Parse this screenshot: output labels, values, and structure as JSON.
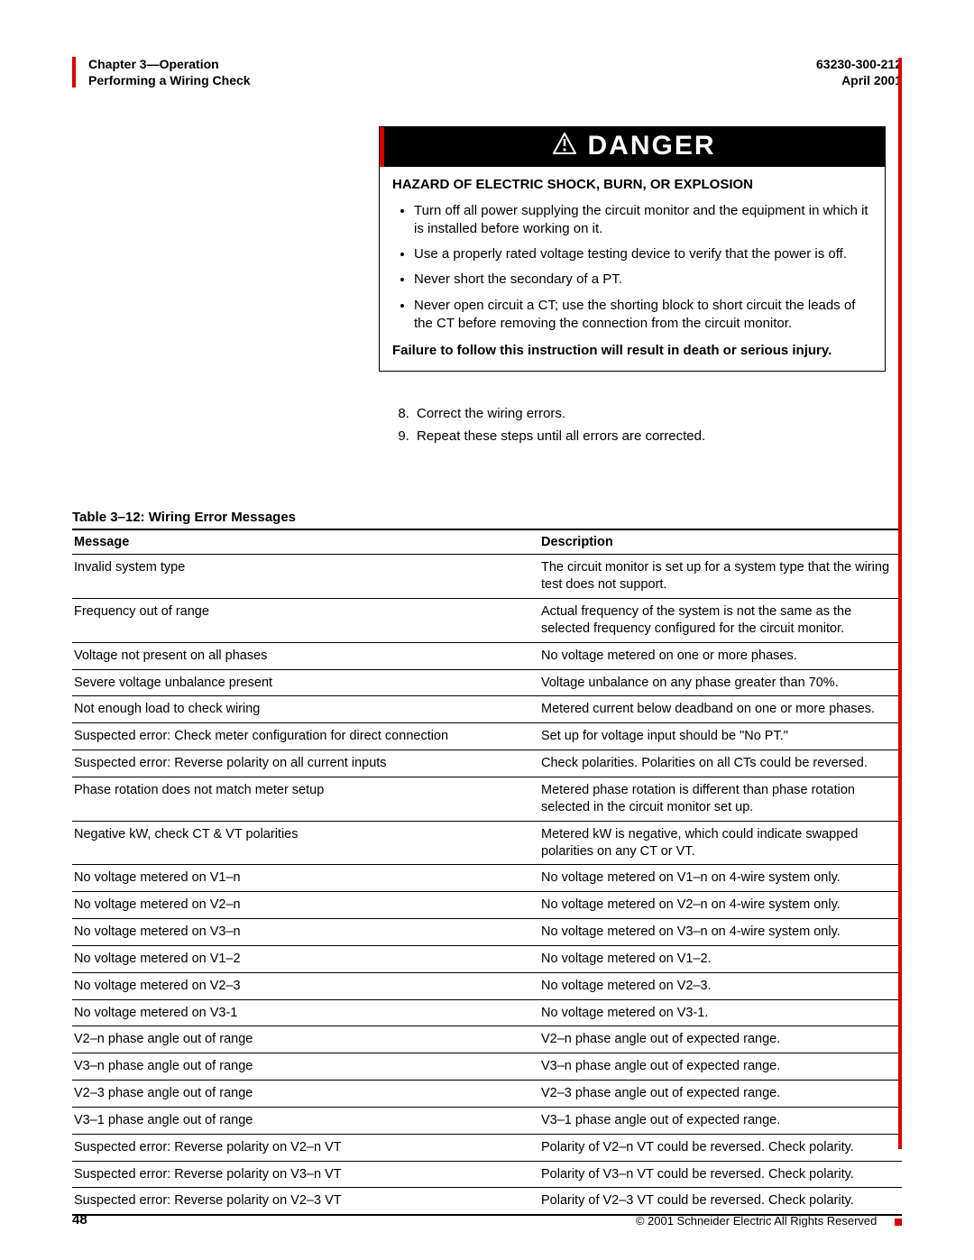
{
  "header": {
    "chapter": "Chapter 3—Operation",
    "section": "Performing a Wiring Check",
    "docnum": "63230-300-212",
    "date": "April 2001"
  },
  "danger": {
    "title": "DANGER",
    "hazard": "HAZARD OF ELECTRIC SHOCK, BURN, OR EXPLOSION",
    "bullets": [
      "Turn off all power supplying the circuit monitor and the equipment in which it is installed before working on it.",
      "Use a properly rated voltage testing device to verify that the power is off.",
      "Never short the secondary of a PT.",
      "Never open circuit a CT; use the shorting block to short circuit the leads of the CT before removing the connection from the circuit monitor."
    ],
    "failure": "Failure to follow this instruction will result in death or serious injury."
  },
  "steps": {
    "items": [
      "Correct the wiring errors.",
      "Repeat these steps until all errors are corrected."
    ]
  },
  "table": {
    "caption": "Table 3–12: Wiring Error Messages",
    "head": {
      "col1": "Message",
      "col2": "Description"
    },
    "rows": [
      {
        "msg": "Invalid system type",
        "desc": "The circuit monitor is set up for a system type that the wiring test does not support."
      },
      {
        "msg": "Frequency out of range",
        "desc": "Actual frequency of the system is not the same as the selected frequency configured for the circuit monitor."
      },
      {
        "msg": "Voltage not present on all phases",
        "desc": "No voltage metered on one or more phases."
      },
      {
        "msg": "Severe voltage unbalance present",
        "desc": "Voltage unbalance on any phase greater than 70%."
      },
      {
        "msg": "Not enough load to check wiring",
        "desc": "Metered current below deadband on one or more phases."
      },
      {
        "msg": "Suspected error: Check meter configuration for direct connection",
        "desc": "Set up for voltage input should be \"No PT.\""
      },
      {
        "msg": "Suspected error: Reverse polarity on all current inputs",
        "desc": "Check polarities. Polarities on all CTs could be reversed."
      },
      {
        "msg": "Phase rotation does not match meter setup",
        "desc": "Metered phase rotation is different than phase rotation selected in the circuit monitor set up."
      },
      {
        "msg": "Negative kW, check CT & VT polarities",
        "desc": "Metered kW is negative, which could indicate swapped polarities on any CT or VT."
      },
      {
        "msg": "No voltage metered on V1–n",
        "desc": "No voltage metered on V1–n on 4-wire system only."
      },
      {
        "msg": "No voltage metered on V2–n",
        "desc": "No voltage metered on V2–n on 4-wire system only."
      },
      {
        "msg": "No voltage metered on V3–n",
        "desc": "No voltage metered on V3–n on 4-wire system only."
      },
      {
        "msg": "No voltage metered on V1–2",
        "desc": "No voltage metered on V1–2."
      },
      {
        "msg": "No voltage metered on V2–3",
        "desc": "No voltage metered on V2–3."
      },
      {
        "msg": "No voltage metered on V3-1",
        "desc": " No voltage metered on V3-1."
      },
      {
        "msg": "V2–n phase angle out of range",
        "desc": "V2–n phase angle out of expected range."
      },
      {
        "msg": "V3–n phase angle out of range",
        "desc": "V3–n phase angle out of expected range."
      },
      {
        "msg": "V2–3 phase angle out of range",
        "desc": "V2–3 phase angle out of expected range."
      },
      {
        "msg": "V3–1 phase angle out of range",
        "desc": "V3–1 phase angle out of expected range."
      },
      {
        "msg": "Suspected error: Reverse polarity on V2–n VT",
        "desc": "Polarity of V2–n VT could be reversed. Check polarity."
      },
      {
        "msg": "Suspected error: Reverse polarity on V3–n VT",
        "desc": "Polarity of V3–n VT could be reversed. Check polarity."
      },
      {
        "msg": "Suspected error: Reverse polarity on V2–3 VT",
        "desc": "Polarity of V2–3 VT could be reversed. Check polarity."
      }
    ]
  },
  "footer": {
    "page": "48",
    "copyright": "© 2001 Schneider Electric  All Rights Reserved"
  }
}
